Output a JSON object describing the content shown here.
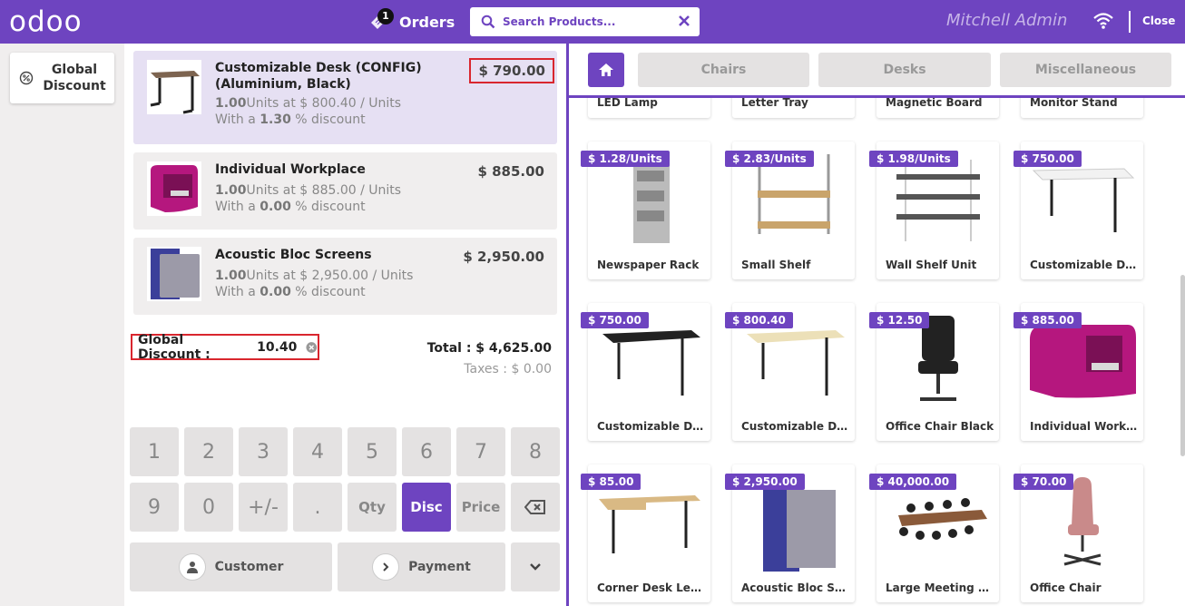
{
  "header": {
    "logo": "odoo",
    "orders_count": "1",
    "orders_label": "Orders",
    "search_placeholder": "Search Products...",
    "user": "Mitchell Admin",
    "close_label": "Close"
  },
  "left_controls": {
    "global_discount_label": "Global Discount"
  },
  "order": {
    "lines": [
      {
        "name": "Customizable Desk (CONFIG) (Aluminium, Black)",
        "price": "$ 790.00",
        "qty": "1.00",
        "unit_text": "Units at $ 800.40 / Units",
        "discount": "1.30",
        "discount_prefix": "With a ",
        "discount_suffix": " % discount"
      },
      {
        "name": "Individual Workplace",
        "price": "$ 885.00",
        "qty": "1.00",
        "unit_text": "Units at $ 885.00 / Units",
        "discount": "0.00",
        "discount_prefix": "With a ",
        "discount_suffix": " % discount"
      },
      {
        "name": "Acoustic Bloc Screens",
        "price": "$ 2,950.00",
        "qty": "1.00",
        "unit_text": "Units at $ 2,950.00 / Units",
        "discount": "0.00",
        "discount_prefix": "With a ",
        "discount_suffix": " % discount"
      }
    ],
    "global_discount_label": "Global Discount :",
    "global_discount_value": "10.40",
    "total": "Total : $ 4,625.00",
    "taxes": "Taxes : $ 0.00"
  },
  "numpad": {
    "keys": [
      "1",
      "2",
      "3",
      "4",
      "5",
      "6",
      "7",
      "8",
      "9",
      "0",
      "+/-",
      ".",
      "Qty",
      "Disc",
      "Price"
    ],
    "customer_label": "Customer",
    "payment_label": "Payment"
  },
  "categories": [
    "Chairs",
    "Desks",
    "Miscellaneous"
  ],
  "products_top_row": [
    "LED Lamp",
    "Letter Tray",
    "Magnetic Board",
    "Monitor Stand"
  ],
  "products": [
    {
      "name": "Newspaper Rack",
      "price": "$ 1.28/Units"
    },
    {
      "name": "Small Shelf",
      "price": "$ 2.83/Units"
    },
    {
      "name": "Wall Shelf Unit",
      "price": "$ 1.98/Units"
    },
    {
      "name": "Customizable Desk (CONFIG)",
      "price": "$ 750.00"
    },
    {
      "name": "Customizable Desk (Custom, White)",
      "price": "$ 750.00"
    },
    {
      "name": "Customizable Desk (Custom, Black)",
      "price": "$ 800.40"
    },
    {
      "name": "Office Chair Black",
      "price": "$ 12.50"
    },
    {
      "name": "Individual Workplace",
      "price": "$ 885.00"
    },
    {
      "name": "Corner Desk Left Sit",
      "price": "$ 85.00"
    },
    {
      "name": "Acoustic Bloc Screens",
      "price": "$ 2,950.00"
    },
    {
      "name": "Large Meeting Table",
      "price": "$ 40,000.00"
    },
    {
      "name": "Office Chair",
      "price": "$ 70.00"
    }
  ],
  "colors": {
    "brand": "#6e44c0",
    "highlight_border": "#d9262e"
  },
  "icons": [
    "orders-ticket-icon",
    "search-icon",
    "close-icon",
    "wifi-icon",
    "discount-icon",
    "backspace-icon",
    "user-icon",
    "chevron-right-icon",
    "chevron-down-icon",
    "home-icon"
  ]
}
